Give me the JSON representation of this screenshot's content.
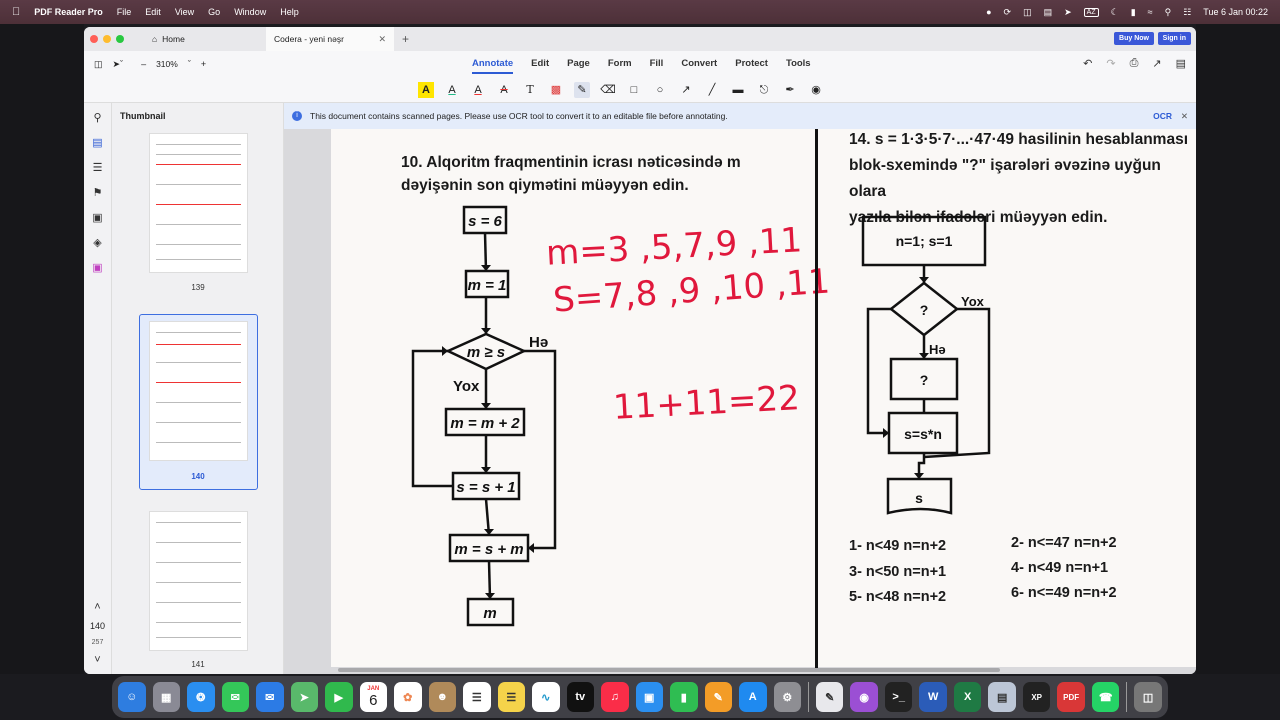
{
  "menubar": {
    "app_name": "PDF Reader Pro",
    "items": [
      "File",
      "Edit",
      "View",
      "Go",
      "Window",
      "Help"
    ],
    "keyboard": "AZ",
    "clock": "Tue 6 Jan  00:22"
  },
  "tabs": {
    "home": "Home",
    "active": "Codera - yeni nəşr",
    "buy_now": "Buy Now",
    "sign_in": "Sign in"
  },
  "toolbar": {
    "zoom": "310%",
    "menu": [
      "Annotate",
      "Edit",
      "Page",
      "Form",
      "Fill",
      "Convert",
      "Protect",
      "Tools"
    ]
  },
  "sidebar": {
    "title": "Thumbnail",
    "thumbs": [
      "139",
      "140",
      "141"
    ],
    "current_page": "140",
    "total_pages": "257"
  },
  "notice": {
    "text": "This document contains scanned pages. Please use OCR tool to convert it to an editable file before annotating.",
    "ocr": "OCR"
  },
  "document": {
    "q10_line1": "10. Alqoritm fraqmentinin icrası nəticəsində m",
    "q10_line2": "dəyişənin son qiymətini müəyyən edin.",
    "flow_left": {
      "s6": "s = 6",
      "m1": "m = 1",
      "cond": "m ≥ s",
      "yes": "Hə",
      "no": "Yox",
      "m_inc": "m = m + 2",
      "s_inc": "s = s + 1",
      "m_sum": "m = s + m",
      "out": "m"
    },
    "handwriting": {
      "line1": "m=3 ,5,7,9 ,11",
      "line2": "S=7,8 ,9 ,10 ,11",
      "line3": "11+11=22"
    },
    "q14_line1": "14. s = 1·3·5·7·...·47·49 hasilinin hesablanması",
    "q14_line2": "blok-sxemində \"?\" işarələri əvəzinə uyğun olara",
    "q14_line3": "yazıla bilən ifadələri müəyyən edin.",
    "flow_right": {
      "init": "n=1; s=1",
      "cond": "?",
      "yes": "Hə",
      "no": "Yox",
      "step": "?",
      "mult": "s=s*n",
      "out": "s"
    },
    "answers": [
      "1- n<49  n=n+2",
      "2- n<=47 n=n+2",
      "3- n<50 n=n+1",
      "4- n<49 n=n+1",
      "5- n<48 n=n+2",
      "6- n<=49 n=n+2"
    ]
  },
  "dock": {
    "calendar_month": "JAN",
    "calendar_day": "6"
  }
}
